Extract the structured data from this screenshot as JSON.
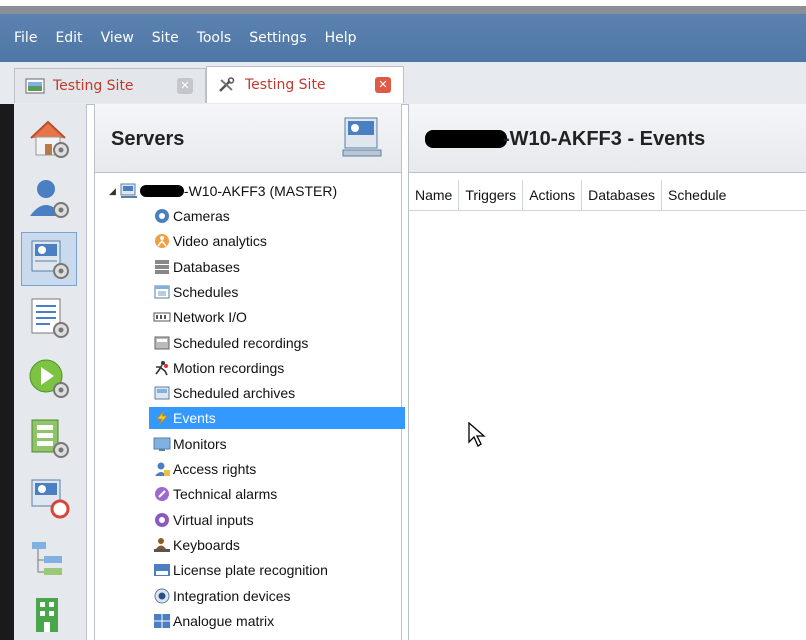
{
  "menu": [
    "File",
    "Edit",
    "View",
    "Site",
    "Tools",
    "Settings",
    "Help"
  ],
  "tabs": [
    {
      "label": "Testing Site",
      "active": false
    },
    {
      "label": "Testing Site",
      "active": true
    }
  ],
  "nav_icons": [
    "site-settings-icon",
    "users-icon",
    "servers-icon",
    "logs-icon",
    "play-settings-icon",
    "hardware-icon",
    "server-config-icon",
    "topology-icon",
    "building-icon"
  ],
  "servers_panel": {
    "title": "Servers"
  },
  "tree": {
    "root": "-W10-AKFF3 (MASTER)",
    "items": [
      {
        "label": "Cameras",
        "icon": "camera-icon"
      },
      {
        "label": "Video analytics",
        "icon": "analytics-icon"
      },
      {
        "label": "Databases",
        "icon": "database-icon"
      },
      {
        "label": "Schedules",
        "icon": "schedule-icon"
      },
      {
        "label": "Network I/O",
        "icon": "network-io-icon"
      },
      {
        "label": "Scheduled recordings",
        "icon": "scheduled-recording-icon"
      },
      {
        "label": "Motion recordings",
        "icon": "motion-icon"
      },
      {
        "label": "Scheduled archives",
        "icon": "archive-icon"
      },
      {
        "label": "Events",
        "icon": "lightning-icon",
        "selected": true
      },
      {
        "label": "Monitors",
        "icon": "monitor-icon"
      },
      {
        "label": "Access rights",
        "icon": "access-rights-icon"
      },
      {
        "label": "Technical alarms",
        "icon": "alarm-icon"
      },
      {
        "label": "Virtual inputs",
        "icon": "virtual-input-icon"
      },
      {
        "label": "Keyboards",
        "icon": "keyboard-icon"
      },
      {
        "label": "License plate recognition",
        "icon": "lpr-icon"
      },
      {
        "label": "Integration devices",
        "icon": "integration-icon"
      },
      {
        "label": "Analogue matrix",
        "icon": "matrix-icon"
      }
    ]
  },
  "events_panel": {
    "title": "-W10-AKFF3 - Events",
    "columns": [
      "Name",
      "Triggers",
      "Actions",
      "Databases",
      "Schedule"
    ]
  },
  "colors": {
    "menubar": "#5078a8",
    "selected": "#3399ff",
    "tab_text": "#c0392b"
  }
}
